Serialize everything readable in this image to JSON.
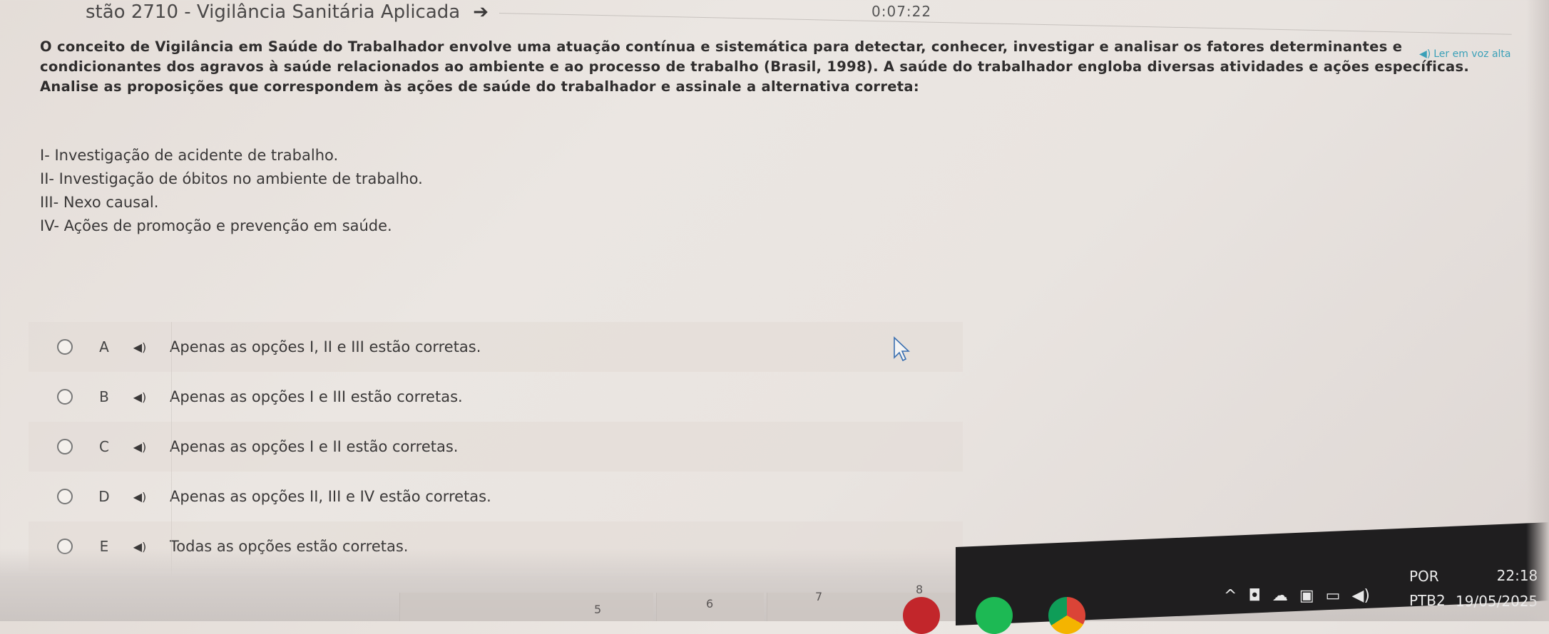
{
  "header": {
    "question_title": "stão 2710 - Vigilância Sanitária Aplicada",
    "timer": "0:07:22",
    "tts_label": "Ler em voz alta"
  },
  "question": {
    "text": "O conceito de Vigilância em Saúde do Trabalhador envolve uma atuação contínua e sistemática para detectar, conhecer, investigar e analisar os fatores determinantes e condicionantes dos agravos à saúde relacionados ao ambiente e ao processo de trabalho (Brasil, 1998). A saúde do trabalhador engloba diversas atividades e ações específicas. Analise as proposições que correspondem às ações de saúde do trabalhador e assinale a alternativa correta:",
    "propositions": [
      "I- Investigação de acidente de trabalho.",
      "II- Investigação de óbitos no ambiente de trabalho.",
      "III- Nexo causal.",
      "IV- Ações de promoção e prevenção em saúde."
    ]
  },
  "options": [
    {
      "letter": "A",
      "text": "Apenas as opções I, II e III estão corretas."
    },
    {
      "letter": "B",
      "text": "Apenas as opções I e III estão corretas."
    },
    {
      "letter": "C",
      "text": "Apenas as opções I e II estão corretas."
    },
    {
      "letter": "D",
      "text": "Apenas as opções II, III e IV estão corretas."
    },
    {
      "letter": "E",
      "text": "Todas as opções estão corretas."
    }
  ],
  "page_numbers": [
    "5",
    "6",
    "7",
    "8"
  ],
  "taskbar": {
    "lang_top": "POR",
    "lang_bottom": "PTB2",
    "time": "22:18",
    "date": "19/05/2025"
  },
  "icons": {
    "arrow": "arrow-right-icon",
    "speaker": "speaker-icon",
    "cursor": "mouse-cursor-icon"
  }
}
